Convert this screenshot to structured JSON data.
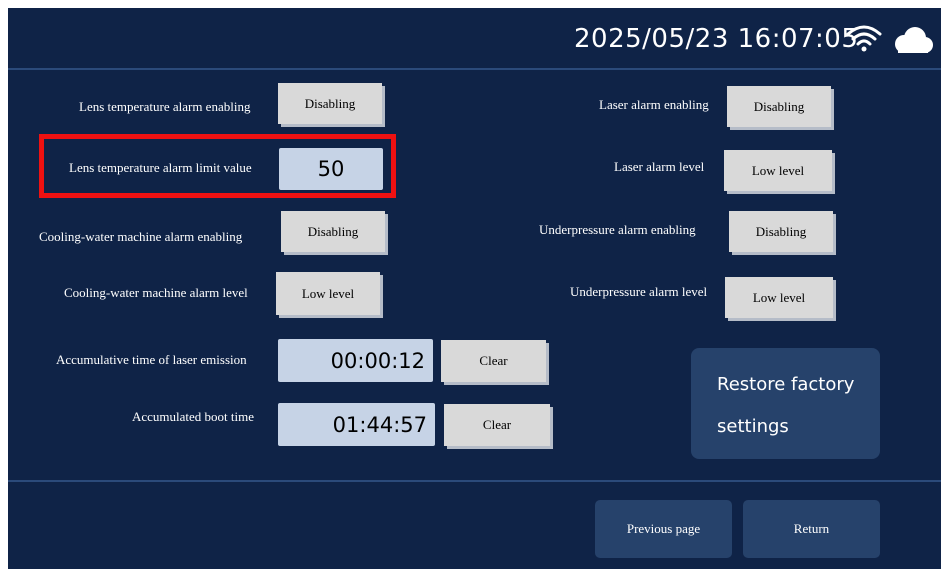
{
  "status": {
    "datetime": "2025/05/23 16:07:05"
  },
  "icons": {
    "wifi": "wifi-icon",
    "cloud": "cloud-icon"
  },
  "settings": {
    "lens_temp_alarm_enabling": {
      "label": "Lens temperature alarm enabling",
      "value": "Disabling"
    },
    "lens_temp_alarm_limit": {
      "label": "Lens temperature alarm limit value",
      "value": "50"
    },
    "cooling_alarm_enabling": {
      "label": "Cooling-water machine alarm enabling",
      "value": "Disabling"
    },
    "cooling_alarm_level": {
      "label": "Cooling-water machine alarm level",
      "value": "Low level"
    },
    "laser_emission_time": {
      "label": "Accumulative time of laser emission",
      "value": "00:00:12",
      "clear": "Clear"
    },
    "boot_time": {
      "label": "Accumulated boot time",
      "value": "01:44:57",
      "clear": "Clear"
    },
    "laser_alarm_enabling": {
      "label": "Laser alarm enabling",
      "value": "Disabling"
    },
    "laser_alarm_level": {
      "label": "Laser alarm level",
      "value": "Low level"
    },
    "underpressure_alarm_enabling": {
      "label": "Underpressure alarm enabling",
      "value": "Disabling"
    },
    "underpressure_alarm_level": {
      "label": "Underpressure alarm level",
      "value": "Low level"
    }
  },
  "restore": {
    "line1": "Restore factory",
    "line2": "settings"
  },
  "nav": {
    "previous": "Previous page",
    "return": "Return"
  },
  "colors": {
    "background": "#0f2347",
    "highlight": "#ee1111",
    "button": "#d9d9d9",
    "value_box": "#c6d3e6"
  }
}
